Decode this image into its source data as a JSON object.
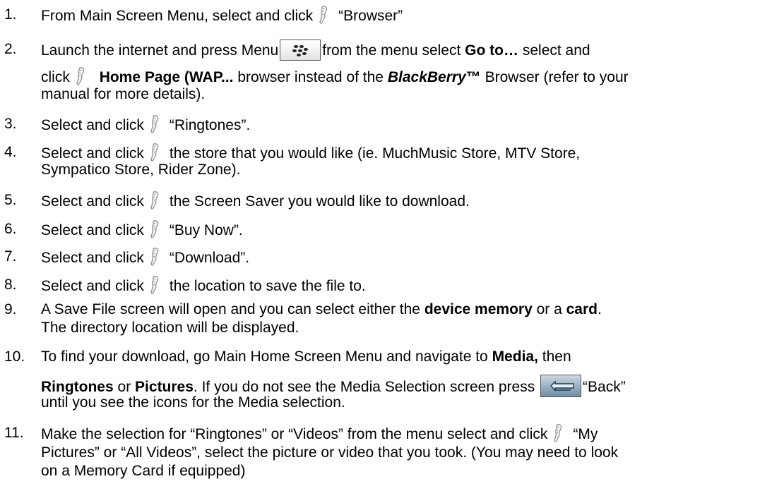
{
  "steps": [
    {
      "num": "1.",
      "before": "From Main Screen Menu, select and click",
      "after": "“Browser”"
    },
    {
      "num": "2.",
      "a": "Launch the internet and press Menu",
      "b": "from the menu select",
      "b_bold": "Go to…",
      "c": "select and",
      "d": "click",
      "d_bold": "Home Page (WAP...",
      "e": "browser instead of the",
      "e_bolditalic": "BlackBerry",
      "tm": "™",
      "f": "Browser (refer to your",
      "g": "manual for more details)."
    },
    {
      "num": "3.",
      "before": "Select and click",
      "after": "“Ringtones”."
    },
    {
      "num": "4.",
      "before": "Select and click",
      "after": "the store that you would like (ie. MuchMusic Store, MTV Store,",
      "line2": "Sympatico Store, Rider Zone)."
    },
    {
      "num": "5.",
      "before": "Select and click",
      "after": "the Screen Saver you would like to download."
    },
    {
      "num": "6.",
      "before": "Select and click",
      "after": "“Buy Now”."
    },
    {
      "num": "7.",
      "before": "Select and click",
      "after": "“Download”."
    },
    {
      "num": "8.",
      "before": "Select and click",
      "after": "the location to save the file to."
    },
    {
      "num": "9.",
      "a": "A Save File screen will open and you can select either the",
      "a_bold": "device memory",
      "b": "or a",
      "b_bold": "card",
      "c": ".",
      "line2": "The directory location will be displayed."
    },
    {
      "num": "10.",
      "a": "To find your download, go Main Home Screen Menu and navigate to",
      "a_bold": "Media,",
      "b": "then",
      "c_bold": "Ringtones",
      "d": "or",
      "d_bold": "Pictures",
      "e": ". If you do not see the Media Selection screen press",
      "f": "“Back”",
      "line3": "until you see the icons for the Media selection."
    },
    {
      "num": "11.",
      "a": "Make the selection for “Ringtones” or “Videos” from the menu select and click",
      "b": "“My",
      "line2": "Pictures” or “All Videos”, select the picture or video that you took. (You may need to look",
      "line3": "on a Memory Card if equipped)"
    }
  ],
  "icons": {
    "trackwheel": "trackwheel-click-icon",
    "menu_key": "blackberry-menu-key-icon",
    "back_key": "back-key-icon"
  }
}
